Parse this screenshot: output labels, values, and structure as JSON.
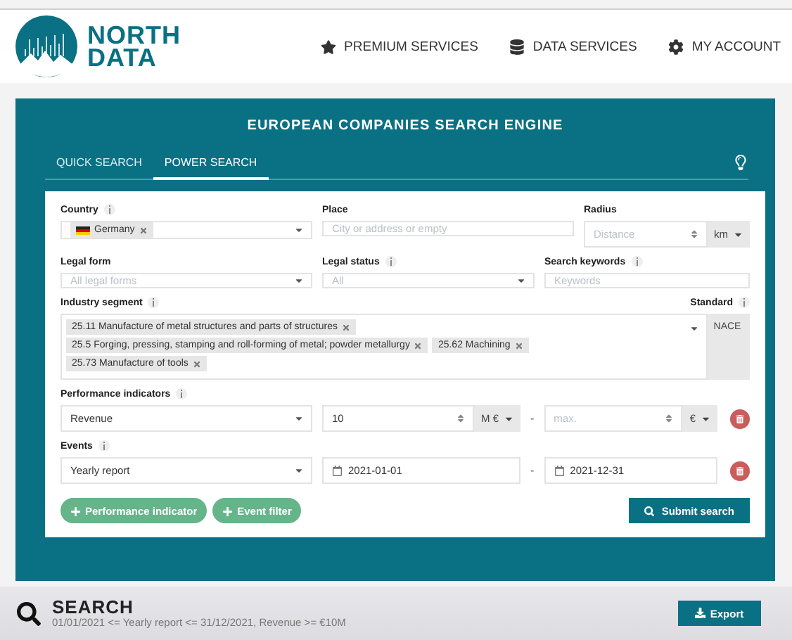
{
  "header": {
    "logo": {
      "line1": "NORTH",
      "line2": "DATA"
    },
    "nav": [
      {
        "label": "PREMIUM SERVICES"
      },
      {
        "label": "DATA SERVICES"
      },
      {
        "label": "MY ACCOUNT"
      }
    ]
  },
  "panel": {
    "title": "EUROPEAN COMPANIES SEARCH ENGINE",
    "tabs": [
      {
        "label": "QUICK SEARCH",
        "selected": false
      },
      {
        "label": "POWER SEARCH",
        "selected": true
      }
    ]
  },
  "form": {
    "country": {
      "label": "Country",
      "info": true,
      "tags": [
        {
          "label": "Germany",
          "flag": true
        }
      ]
    },
    "place": {
      "label": "Place",
      "info": false,
      "placeholder": "City or address or empty"
    },
    "radius": {
      "label": "Radius",
      "info": false,
      "placeholder": "Distance",
      "unit": "km"
    },
    "legal_form": {
      "label": "Legal form",
      "info": false,
      "placeholder": "All legal forms"
    },
    "legal_status": {
      "label": "Legal status",
      "info": true,
      "placeholder": "All"
    },
    "keywords": {
      "label": "Search keywords",
      "info": true,
      "placeholder": "Keywords"
    },
    "industry": {
      "label": "Industry segment",
      "info": true,
      "tags": [
        {
          "label": "25.11 Manufacture of metal structures and parts of structures",
          "flag": false
        },
        {
          "label": "25.5 Forging, pressing, stamping and roll-forming of metal; powder metallurgy",
          "flag": false
        },
        {
          "label": "25.62 Machining",
          "flag": false
        },
        {
          "label": "25.73 Manufacture of tools",
          "flag": false
        }
      ]
    },
    "standard": {
      "label": "Standard",
      "info": true,
      "value": "NACE"
    },
    "performance": {
      "label": "Performance indicators",
      "info": true,
      "indicator": "Revenue",
      "min": "10",
      "min_unit": "M €",
      "separator": "-",
      "max_placeholder": "max.",
      "max_unit": "€"
    },
    "events": {
      "label": "Events",
      "info": true,
      "event": "Yearly report",
      "from": "2021-01-01",
      "separator": "-",
      "to": "2021-12-31"
    },
    "add_buttons": [
      "Performance indicator",
      "Event filter"
    ],
    "submit": "Submit search"
  },
  "summary": {
    "title": "SEARCH",
    "query": "01/01/2021 <= Yearly report <= 31/12/2021, Revenue >= €10M",
    "export": "Export"
  }
}
